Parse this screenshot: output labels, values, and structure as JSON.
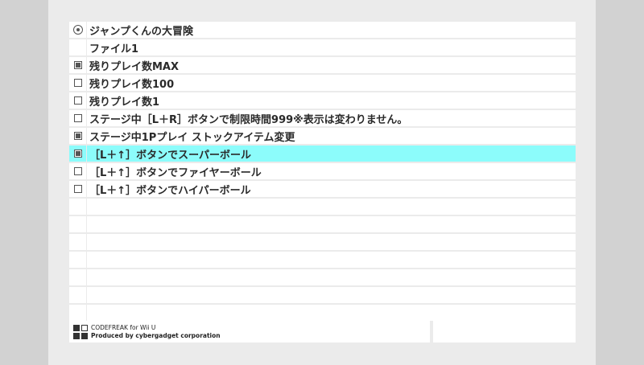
{
  "game_title": "ジャンプくんの大冒険",
  "cheats": [
    {
      "label": "ファイル1",
      "icon": "none",
      "checked": false
    },
    {
      "label": "残りプレイ数MAX",
      "icon": "checkbox",
      "checked": true
    },
    {
      "label": "残りプレイ数100",
      "icon": "checkbox",
      "checked": false
    },
    {
      "label": "残りプレイ数1",
      "icon": "checkbox",
      "checked": false
    },
    {
      "label": "ステージ中［L＋R］ボタンで制限時間999※表示は変わりません。",
      "icon": "checkbox",
      "checked": false
    },
    {
      "label": "ステージ中1Pプレイ ストックアイテム変更",
      "icon": "checkbox",
      "checked": true
    },
    {
      "label": "［L＋↑］ボタンでスーパーボール",
      "icon": "checkbox",
      "checked": true,
      "selected": true
    },
    {
      "label": "［L＋↑］ボタンでファイヤーボール",
      "icon": "checkbox",
      "checked": false
    },
    {
      "label": "［L＋↑］ボタンでハイパーボール",
      "icon": "checkbox",
      "checked": false
    }
  ],
  "footer": {
    "brand_line1": "CODEFREAK for Wii U",
    "brand_line2": "Produced by cybergadget corporation"
  },
  "colors": {
    "selected_row": "#8cfcfb",
    "background": "#d2d2d2",
    "panel": "#ebebeb"
  }
}
